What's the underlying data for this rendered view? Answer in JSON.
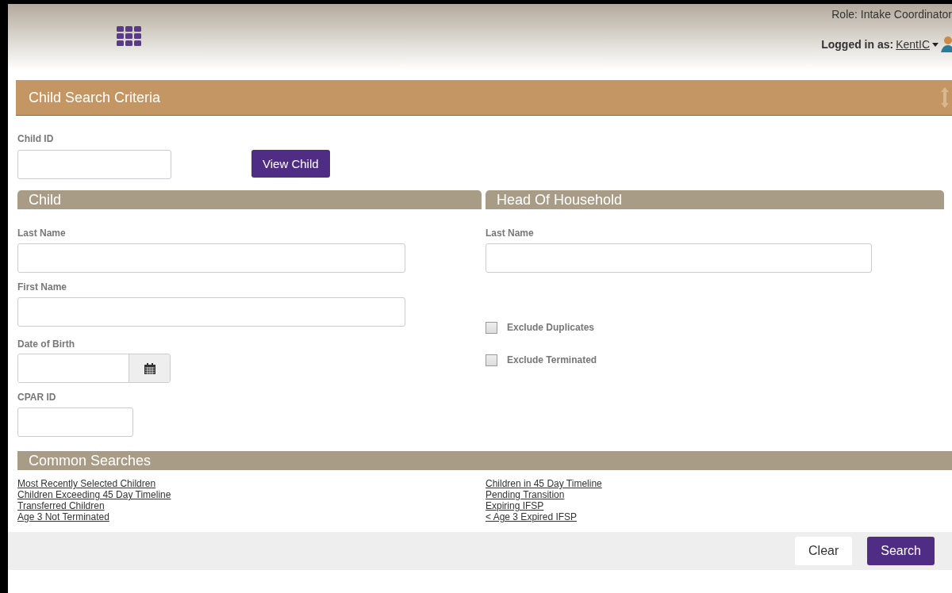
{
  "header": {
    "role": "Role: Intake Coordinator",
    "logged_in_label": "Logged in as:",
    "user": "KentIC"
  },
  "panel": {
    "title": "Child Search Criteria"
  },
  "child_id": {
    "label": "Child ID",
    "button": "View Child"
  },
  "child": {
    "title": "Child",
    "last_name": "Last Name",
    "first_name": "First Name",
    "dob": "Date of Birth",
    "cpar": "CPAR ID"
  },
  "household": {
    "title": "Head Of Household",
    "last_name": "Last Name",
    "options": [
      {
        "label": "Exclude Duplicates",
        "checked": false
      },
      {
        "label": "Exclude Terminated",
        "checked": false
      }
    ]
  },
  "common": {
    "title": "Common Searches",
    "left": [
      "Most Recently Selected Children",
      "Children Exceeding 45 Day Timeline",
      "Transferred Children",
      "Age 3 Not Terminated"
    ],
    "right": [
      "Children in 45 Day Timeline",
      "Pending Transition",
      "Expiring IFSP",
      "< Age 3 Expired IFSP"
    ]
  },
  "buttons": {
    "clear": "Clear",
    "search": "Search"
  }
}
